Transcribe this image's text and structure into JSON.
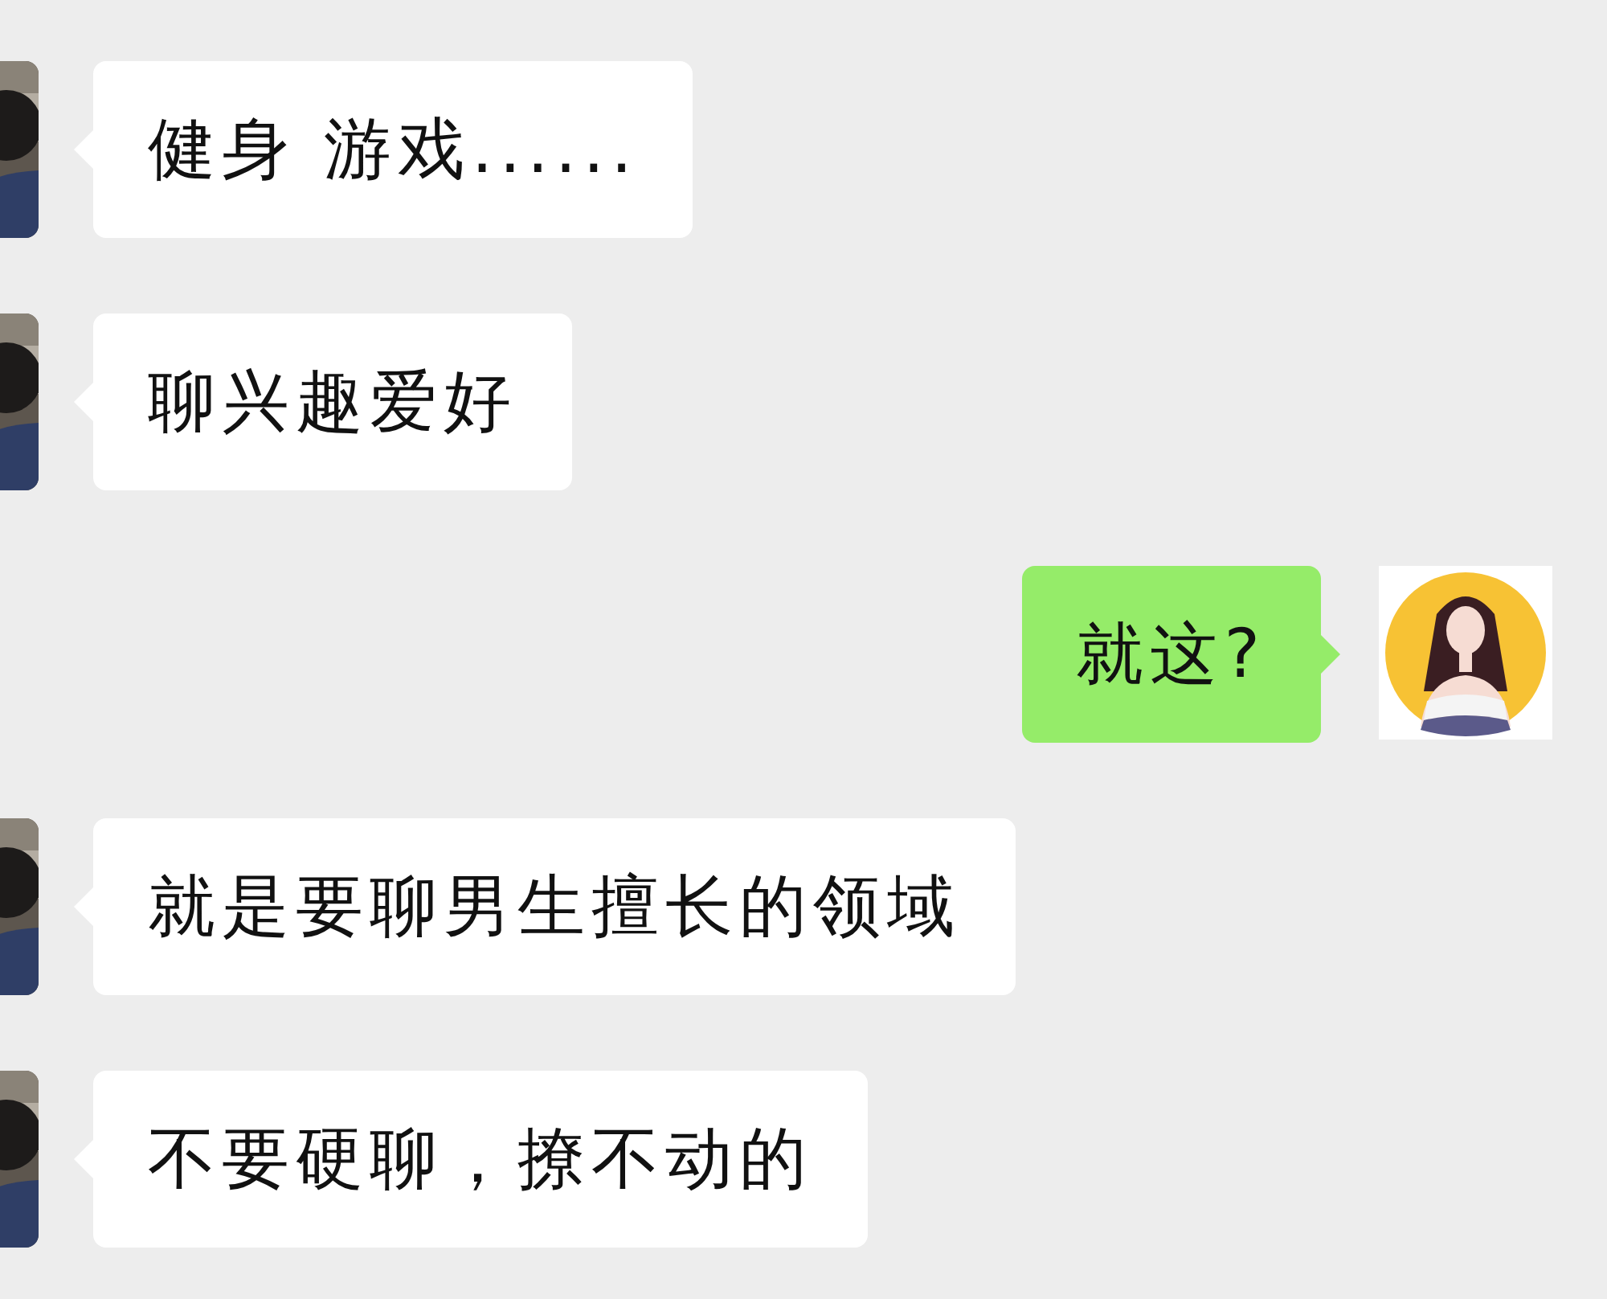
{
  "messages": [
    {
      "kind": "received",
      "text": "健身 游戏......"
    },
    {
      "kind": "received",
      "text": "聊兴趣爱好"
    },
    {
      "kind": "sent",
      "text": "就这?"
    },
    {
      "kind": "received",
      "text": "就是要聊男生擅长的领域"
    },
    {
      "kind": "received",
      "text": "不要硬聊，撩不动的"
    }
  ]
}
